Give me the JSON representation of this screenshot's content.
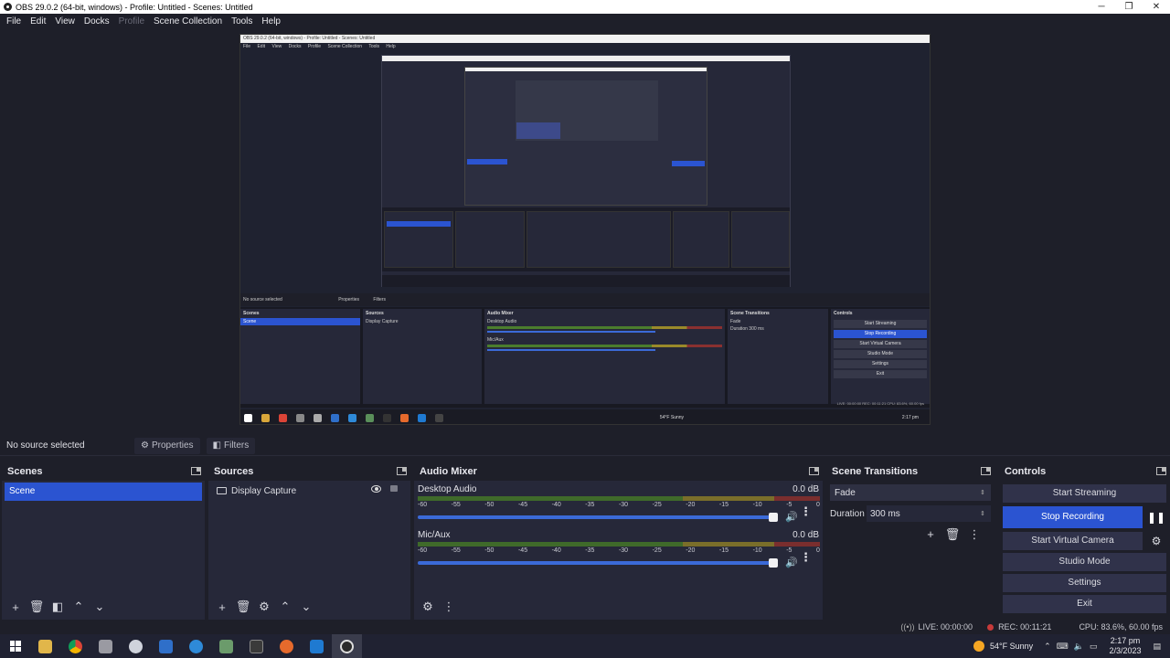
{
  "window": {
    "title": "OBS 29.0.2 (64-bit, windows) - Profile: Untitled - Scenes: Untitled",
    "minimize": "─",
    "maximize": "❐",
    "close": "✕"
  },
  "menu": {
    "items": [
      "File",
      "Edit",
      "View",
      "Docks",
      "Profile",
      "Scene Collection",
      "Tools",
      "Help"
    ]
  },
  "source_toolbar": {
    "no_source": "No source selected",
    "properties": "Properties",
    "filters": "Filters"
  },
  "scenes": {
    "title": "Scenes",
    "items": [
      "Scene"
    ]
  },
  "sources": {
    "title": "Sources",
    "items": [
      "Display Capture"
    ]
  },
  "audio_mixer": {
    "title": "Audio Mixer",
    "ticks": [
      "-60",
      "-55",
      "-50",
      "-45",
      "-40",
      "-35",
      "-30",
      "-25",
      "-20",
      "-15",
      "-10",
      "-5",
      "0"
    ],
    "tracks": [
      {
        "name": "Desktop Audio",
        "db": "0.0 dB"
      },
      {
        "name": "Mic/Aux",
        "db": "0.0 dB"
      }
    ]
  },
  "scene_transitions": {
    "title": "Scene Transitions",
    "transition": "Fade",
    "duration_label": "Duration",
    "duration_value": "300 ms"
  },
  "controls": {
    "title": "Controls",
    "start_streaming": "Start Streaming",
    "stop_recording": "Stop Recording",
    "start_virtual_camera": "Start Virtual Camera",
    "studio_mode": "Studio Mode",
    "settings": "Settings",
    "exit": "Exit"
  },
  "status": {
    "live": "LIVE: 00:00:00",
    "rec": "REC: 00:11:21",
    "cpu": "CPU: 83.6%, 60.00 fps"
  },
  "taskbar": {
    "weather": "54°F  Sunny",
    "time": "2:17 pm",
    "date": "2/3/2023"
  },
  "preview": {
    "title": "OBS 29.0.2 (64-bit, windows) - Profile: Untitled - Scenes: Untitled",
    "no_source": "No source selected",
    "properties": "Properties",
    "filters": "Filters",
    "scenes": "Scenes",
    "scene": "Scene",
    "sources": "Sources",
    "display_capture": "Display Capture",
    "audio_mixer": "Audio Mixer",
    "desktop_audio": "Desktop Audio",
    "mic_aux": "Mic/Aux",
    "scene_transitions": "Scene Transitions",
    "fade": "Fade",
    "duration": "Duration",
    "duration_value": "300 ms",
    "controls": "Controls",
    "start_streaming": "Start Streaming",
    "stop_recording": "Stop Recording",
    "start_virtual_camera": "Start Virtual Camera",
    "studio_mode": "Studio Mode",
    "settings": "Settings",
    "exit": "Exit",
    "status": "LIVE: 00:00:00   REC: 00:11:21   CPU: 83.6%, 60.00 fps",
    "weather": "54°F  Sunny",
    "time": "2:17 pm"
  },
  "colors": {
    "accent": "#2b54d1",
    "background": "#1e1f29",
    "panel": "#262839",
    "rec_dot": "#c83a3a"
  }
}
